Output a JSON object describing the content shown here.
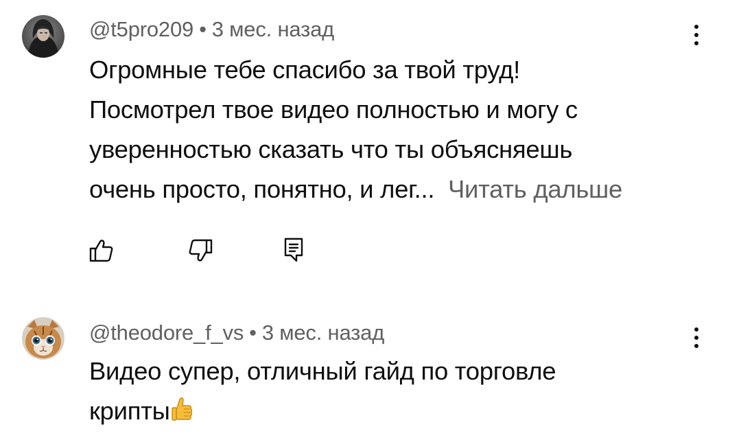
{
  "comments": [
    {
      "author": "@t5pro209",
      "separator": "•",
      "time": "3 мес. назад",
      "lines": [
        "Огромные тебе спасибо за твой труд!",
        "Посмотрел твое видео полностью и могу с",
        "уверенностью сказать что ты объясняешь",
        "очень просто, понятно, и лег..."
      ],
      "read_more": "Читать дальше",
      "avatar": "hooded-person-avatar"
    },
    {
      "author": "@theodore_f_vs",
      "separator": "•",
      "time": "3 мес. назад",
      "lines": [
        "Видео супер, отличный гайд по торговле",
        "крипты"
      ],
      "emoji": "thumbs-up-emoji",
      "avatar": "cat-avatar"
    }
  ],
  "icons": {
    "like": "thumb-up-icon",
    "dislike": "thumb-down-icon",
    "reply": "reply-comment-icon",
    "more": "more-vertical-icon"
  },
  "colors": {
    "text": "#0f0f0f",
    "secondary": "#606060",
    "background": "#ffffff"
  }
}
